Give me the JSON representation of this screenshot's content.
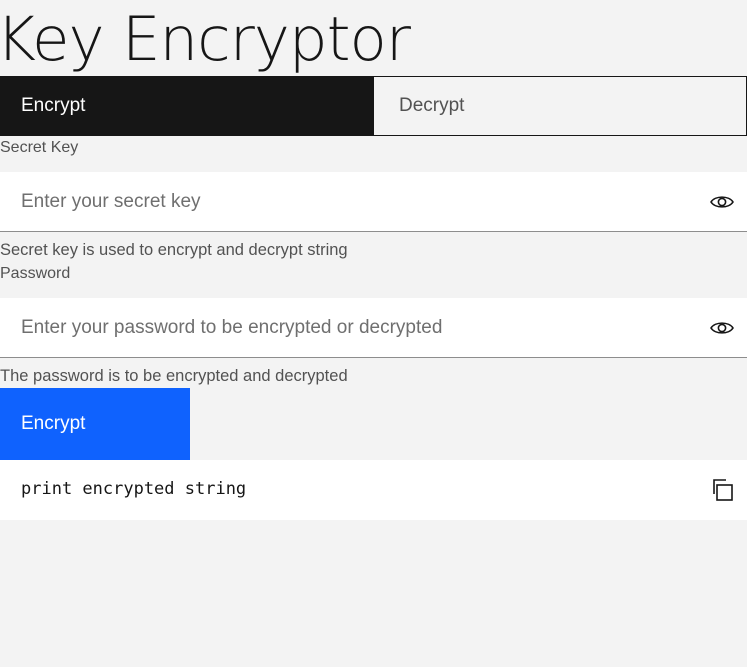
{
  "title": "Key Encryptor",
  "tabs": [
    {
      "label": "Encrypt",
      "active": true
    },
    {
      "label": "Decrypt",
      "active": false
    }
  ],
  "secret_key": {
    "label": "Secret Key",
    "placeholder": "Enter your secret key",
    "value": "",
    "helper": "Secret key is used to encrypt and decrypt string",
    "icon": "eye-icon"
  },
  "password": {
    "label": "Password",
    "placeholder": "Enter your password to be encrypted or decrypted",
    "value": "",
    "helper": "The password is to be encrypted and decrypted",
    "icon": "eye-icon"
  },
  "action_button": {
    "label": "Encrypt"
  },
  "output": {
    "text": "print encrypted string",
    "icon": "copy-icon"
  },
  "colors": {
    "background": "#f3f3f3",
    "active_tab": "#161616",
    "primary_button": "#0f62fe",
    "field": "#ffffff"
  }
}
